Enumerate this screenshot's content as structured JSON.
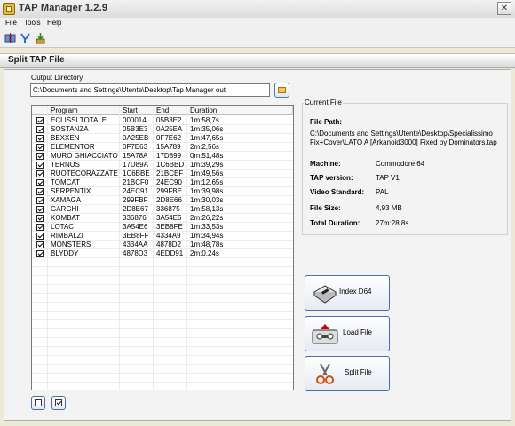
{
  "window": {
    "title": "TAP Manager 1.2.9",
    "close_glyph": "✕"
  },
  "menu": [
    "File",
    "Tools",
    "Help"
  ],
  "section": {
    "title": "Split TAP File"
  },
  "output": {
    "label": "Output Directory",
    "value": "C:\\Documents and Settings\\Utente\\Desktop\\Tap Manager out"
  },
  "table": {
    "columns": [
      "Program",
      "Start",
      "End",
      "Duration"
    ],
    "rows": [
      {
        "program": "ECLISSI TOTALE",
        "start": "000014",
        "end": "05B3E2",
        "duration": "1m:58,7s",
        "checked": true
      },
      {
        "program": "SOSTANZA",
        "start": "05B3E3",
        "end": "0A25EA",
        "duration": "1m:35,06s",
        "checked": true
      },
      {
        "program": "BEXXEN",
        "start": "0A25EB",
        "end": "0F7E62",
        "duration": "1m:47,65s",
        "checked": true
      },
      {
        "program": "ELEMENTOR",
        "start": "0F7E63",
        "end": "15A789",
        "duration": "2m:2,56s",
        "checked": true
      },
      {
        "program": "MURO GHIACCIATO",
        "start": "15A78A",
        "end": "17D899",
        "duration": "0m:51,48s",
        "checked": true
      },
      {
        "program": "TERNUS",
        "start": "17D89A",
        "end": "1C6BBD",
        "duration": "1m:39,29s",
        "checked": true
      },
      {
        "program": "RUOTECORAZZATE",
        "start": "1C6BBE",
        "end": "21BCEF",
        "duration": "1m:49,56s",
        "checked": true
      },
      {
        "program": "TOMCAT",
        "start": "21BCF0",
        "end": "24EC90",
        "duration": "1m:12,65s",
        "checked": true
      },
      {
        "program": "SERPENTIX",
        "start": "24EC91",
        "end": "299FBE",
        "duration": "1m:39,98s",
        "checked": true
      },
      {
        "program": "XAMAGA",
        "start": "299FBF",
        "end": "2D8E66",
        "duration": "1m:30,03s",
        "checked": true
      },
      {
        "program": "GARGHI",
        "start": "2D8E67",
        "end": "336875",
        "duration": "1m:58,13s",
        "checked": true
      },
      {
        "program": "KOMBAT",
        "start": "336876",
        "end": "3A54E5",
        "duration": "2m:26,22s",
        "checked": true
      },
      {
        "program": "LOTAC",
        "start": "3A54E6",
        "end": "3EB8FE",
        "duration": "1m:33,53s",
        "checked": true
      },
      {
        "program": "RIMBALZI",
        "start": "3EB8FF",
        "end": "4334A9",
        "duration": "1m:34,94s",
        "checked": true
      },
      {
        "program": "MONSTERS",
        "start": "4334AA",
        "end": "4878D2",
        "duration": "1m:48,78s",
        "checked": true
      },
      {
        "program": "BLYDDY",
        "start": "4878D3",
        "end": "4EDD91",
        "duration": "2m:0,24s",
        "checked": true
      }
    ]
  },
  "current_file": {
    "legend": "Current File",
    "path_label": "File Path:",
    "path_value": "C:\\Documents and Settings\\Utente\\Desktop\\Specialissimo Fix+Cover\\LATO A [Arkanoid3000] Fixed by Dominators.tap",
    "fields": [
      {
        "label": "Machine:",
        "value": "Commodore 64"
      },
      {
        "label": "TAP version:",
        "value": "TAP V1"
      },
      {
        "label": "Video Standard:",
        "value": "PAL"
      },
      {
        "label": "File Size:",
        "value": "4,93 MB"
      },
      {
        "label": "Total Duration:",
        "value": "27m:28,8s"
      }
    ]
  },
  "buttons": {
    "index": "Index D64",
    "load": "Load File",
    "split": "Split File"
  },
  "icons": [
    "app-icon",
    "close-icon",
    "toolbar-split-icon",
    "toolbar-merge-icon",
    "toolbar-info-icon",
    "folder-icon",
    "disk-drive-icon",
    "cassette-icon",
    "scissors-icon",
    "uncheck-all-icon",
    "check-all-icon"
  ]
}
